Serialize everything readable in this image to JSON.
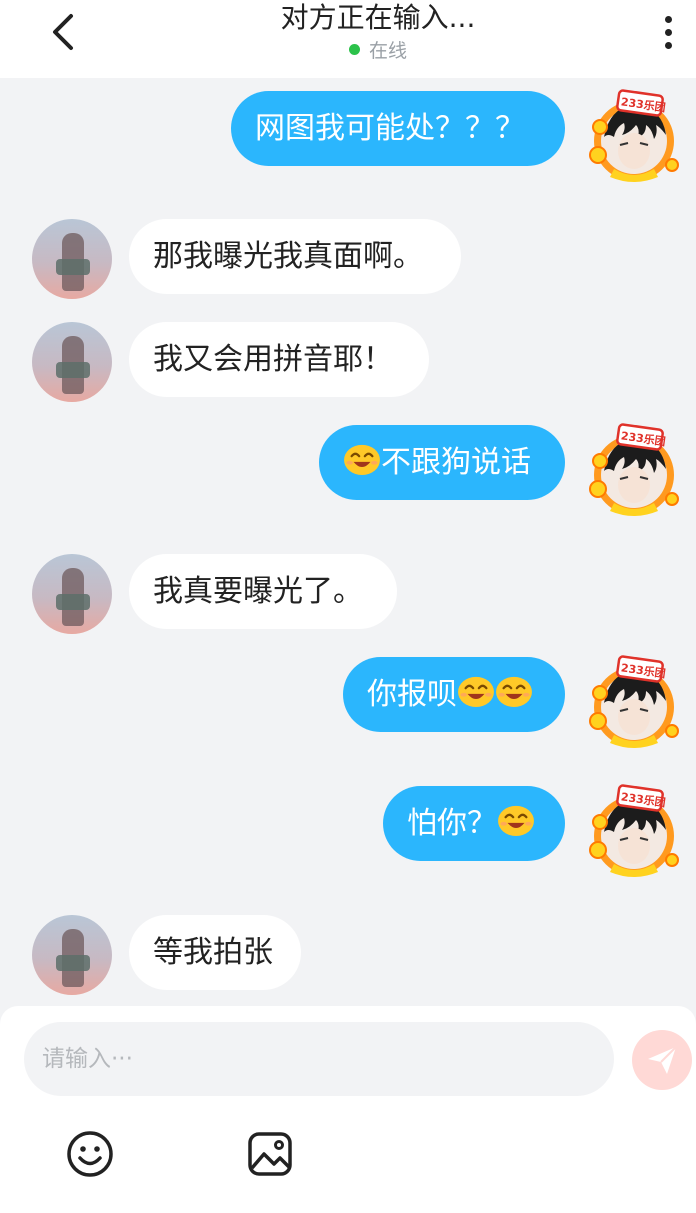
{
  "header": {
    "title": "对方正在输入...",
    "status": "在线",
    "status_color": "#2bc24a"
  },
  "icons": {
    "back": "chevron-left-icon",
    "more": "more-vertical-icon",
    "send": "send-icon",
    "emoji": "smile-icon",
    "image": "image-icon"
  },
  "messages": [
    {
      "from": "me",
      "text": "网图我可能处？？？"
    },
    {
      "from": "other",
      "text": "那我曝光我真面啊。"
    },
    {
      "from": "other",
      "text": "我又会用拼音耶！"
    },
    {
      "from": "me",
      "text": "不跟狗说话",
      "emoji_before": 1
    },
    {
      "from": "other",
      "text": "我真要曝光了。"
    },
    {
      "from": "me",
      "text": "你报呗",
      "emoji_after": 2
    },
    {
      "from": "me",
      "text": "怕你？",
      "emoji_after": 1
    },
    {
      "from": "other",
      "text": "等我拍张"
    }
  ],
  "avatar_badge": "233乐团",
  "composer": {
    "placeholder": "请输入···"
  },
  "colors": {
    "outgoing_bubble": "#2bb6fd",
    "incoming_bubble": "#ffffff",
    "background": "#f2f3f5"
  }
}
